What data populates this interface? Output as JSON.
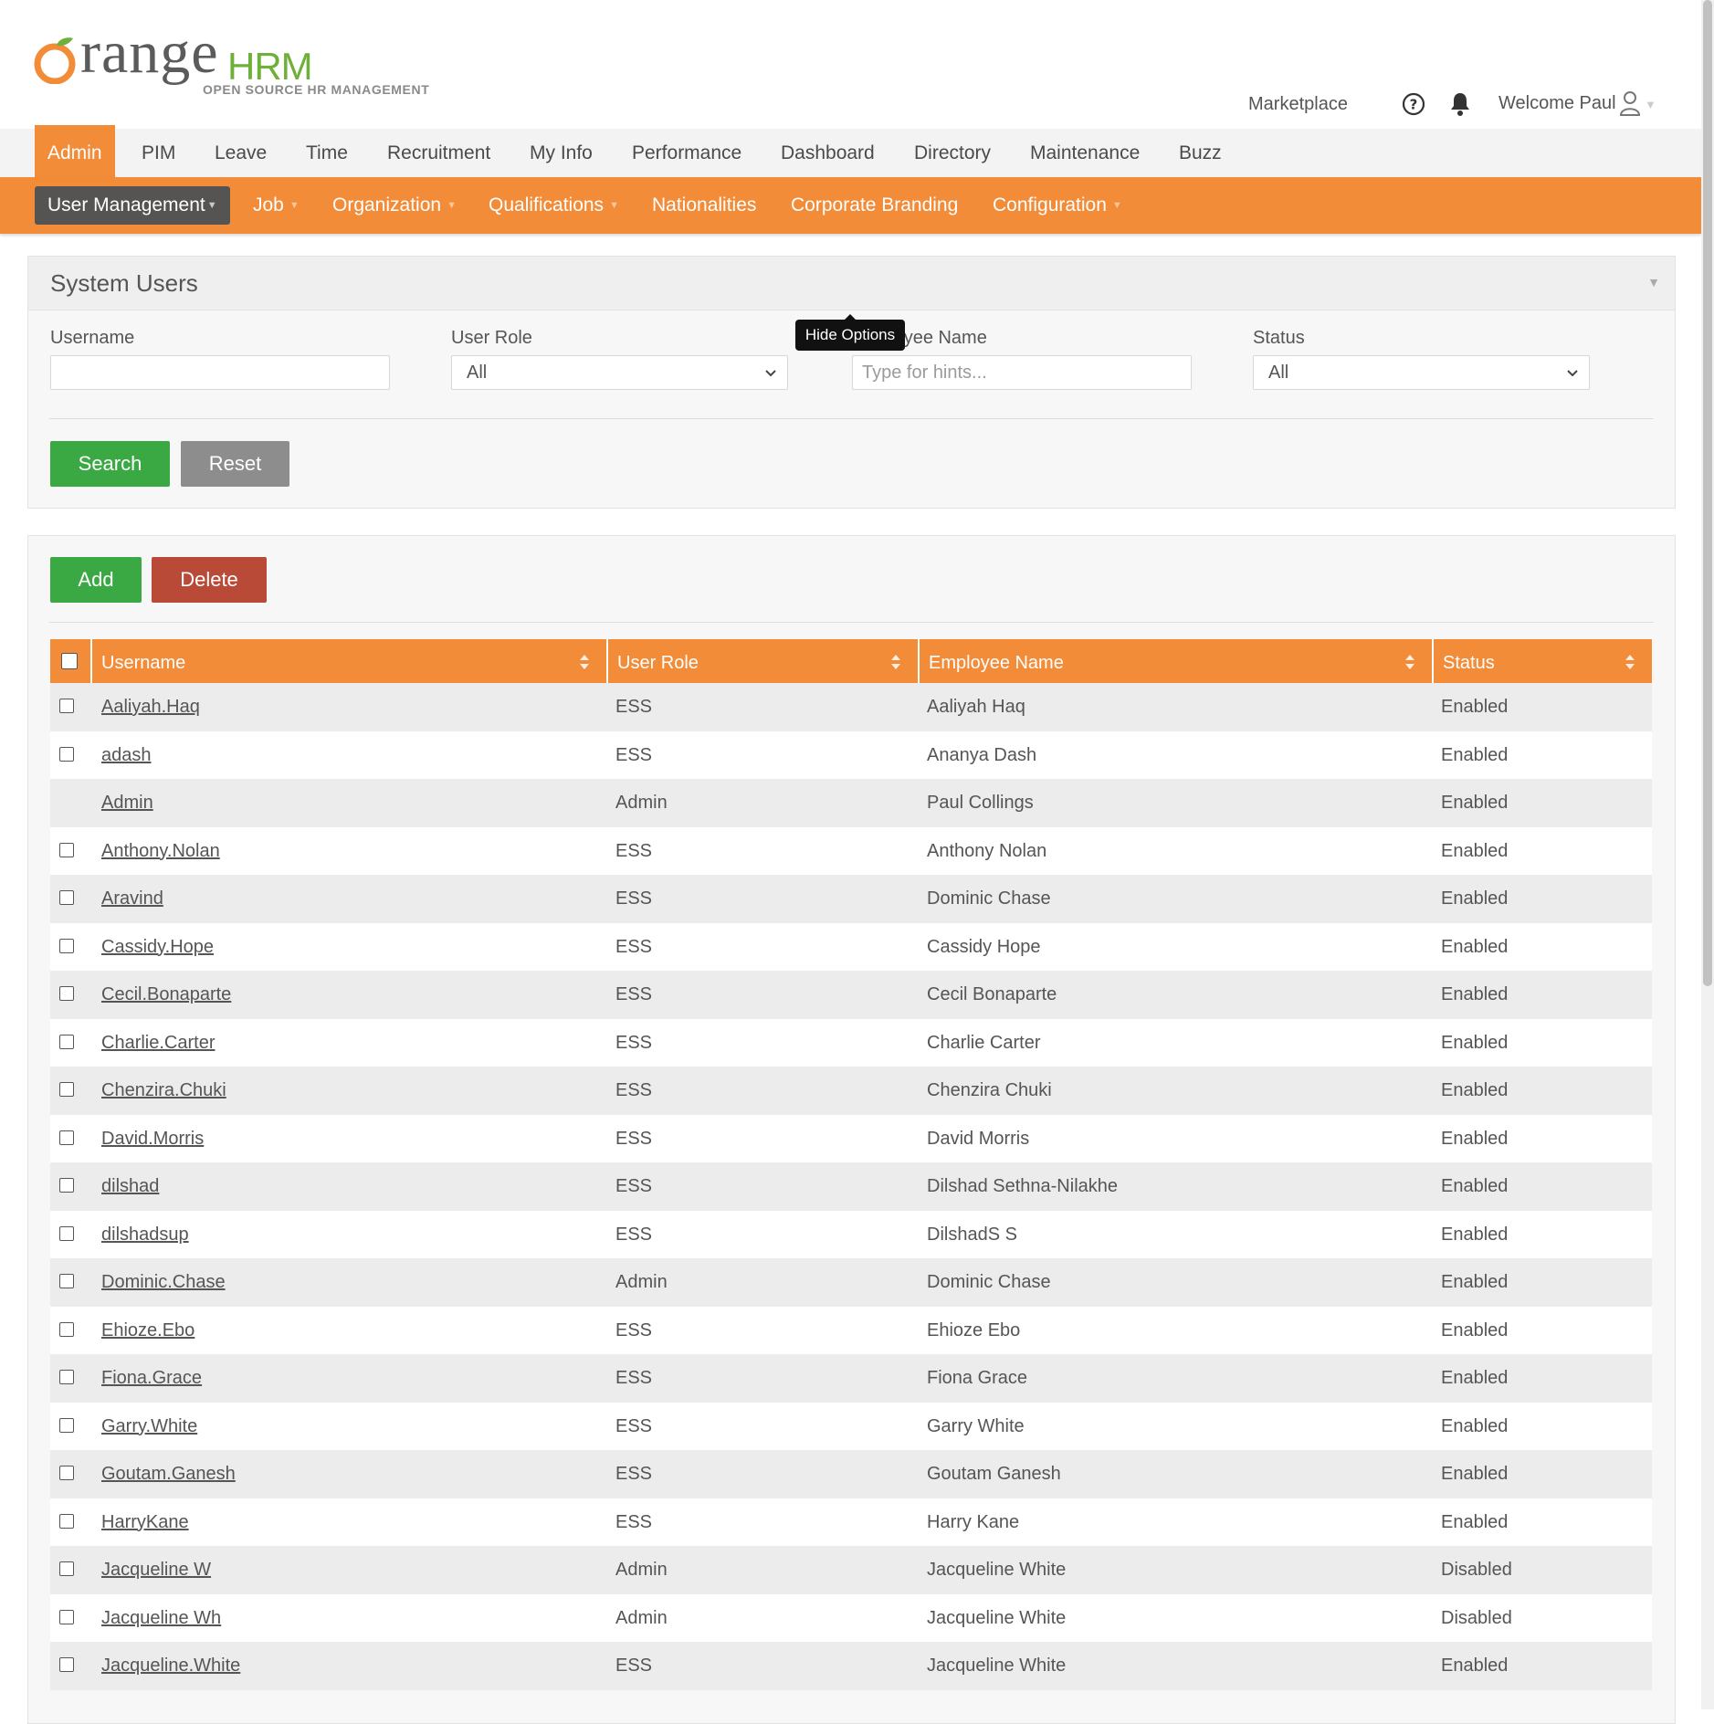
{
  "header": {
    "logo_word": "range",
    "logo_hrm": "HRM",
    "logo_tagline": "OPEN SOURCE HR MANAGEMENT",
    "marketplace": "Marketplace",
    "welcome": "Welcome Paul"
  },
  "main_nav": [
    "Admin",
    "PIM",
    "Leave",
    "Time",
    "Recruitment",
    "My Info",
    "Performance",
    "Dashboard",
    "Directory",
    "Maintenance",
    "Buzz"
  ],
  "sub_nav": [
    {
      "label": "User Management",
      "caret": true
    },
    {
      "label": "Job",
      "caret": true
    },
    {
      "label": "Organization",
      "caret": true
    },
    {
      "label": "Qualifications",
      "caret": true
    },
    {
      "label": "Nationalities",
      "caret": false
    },
    {
      "label": "Corporate Branding",
      "caret": false
    },
    {
      "label": "Configuration",
      "caret": true
    }
  ],
  "search": {
    "title": "System Users",
    "username_label": "Username",
    "username_value": "",
    "user_role_label": "User Role",
    "user_role_value": "All",
    "employee_label": "Employee Name",
    "employee_placeholder": "Type for hints...",
    "status_label": "Status",
    "status_value": "All",
    "search_button": "Search",
    "reset_button": "Reset",
    "tooltip": "Hide Options"
  },
  "list": {
    "add_button": "Add",
    "delete_button": "Delete",
    "columns": [
      "Username",
      "User Role",
      "Employee Name",
      "Status"
    ],
    "rows": [
      {
        "username": "Aaliyah.Haq",
        "role": "ESS",
        "employee": "Aaliyah Haq",
        "status": "Enabled",
        "checkbox": true
      },
      {
        "username": "adash",
        "role": "ESS",
        "employee": "Ananya Dash",
        "status": "Enabled",
        "checkbox": true
      },
      {
        "username": "Admin",
        "role": "Admin",
        "employee": "Paul Collings",
        "status": "Enabled",
        "checkbox": false
      },
      {
        "username": "Anthony.Nolan",
        "role": "ESS",
        "employee": "Anthony Nolan",
        "status": "Enabled",
        "checkbox": true
      },
      {
        "username": "Aravind",
        "role": "ESS",
        "employee": "Dominic Chase",
        "status": "Enabled",
        "checkbox": true
      },
      {
        "username": "Cassidy.Hope",
        "role": "ESS",
        "employee": "Cassidy Hope",
        "status": "Enabled",
        "checkbox": true
      },
      {
        "username": "Cecil.Bonaparte",
        "role": "ESS",
        "employee": "Cecil Bonaparte",
        "status": "Enabled",
        "checkbox": true
      },
      {
        "username": "Charlie.Carter",
        "role": "ESS",
        "employee": "Charlie Carter",
        "status": "Enabled",
        "checkbox": true
      },
      {
        "username": "Chenzira.Chuki",
        "role": "ESS",
        "employee": "Chenzira Chuki",
        "status": "Enabled",
        "checkbox": true
      },
      {
        "username": "David.Morris",
        "role": "ESS",
        "employee": "David Morris",
        "status": "Enabled",
        "checkbox": true
      },
      {
        "username": "dilshad",
        "role": "ESS",
        "employee": "Dilshad Sethna-Nilakhe",
        "status": "Enabled",
        "checkbox": true
      },
      {
        "username": "dilshadsup",
        "role": "ESS",
        "employee": "DilshadS S",
        "status": "Enabled",
        "checkbox": true
      },
      {
        "username": "Dominic.Chase",
        "role": "Admin",
        "employee": "Dominic Chase",
        "status": "Enabled",
        "checkbox": true
      },
      {
        "username": "Ehioze.Ebo",
        "role": "ESS",
        "employee": "Ehioze Ebo",
        "status": "Enabled",
        "checkbox": true
      },
      {
        "username": "Fiona.Grace",
        "role": "ESS",
        "employee": "Fiona Grace",
        "status": "Enabled",
        "checkbox": true
      },
      {
        "username": "Garry.White",
        "role": "ESS",
        "employee": "Garry White",
        "status": "Enabled",
        "checkbox": true
      },
      {
        "username": "Goutam.Ganesh",
        "role": "ESS",
        "employee": "Goutam Ganesh",
        "status": "Enabled",
        "checkbox": true
      },
      {
        "username": "HarryKane",
        "role": "ESS",
        "employee": "Harry Kane",
        "status": "Enabled",
        "checkbox": true
      },
      {
        "username": "Jacqueline W",
        "role": "Admin",
        "employee": "Jacqueline White",
        "status": "Disabled",
        "checkbox": true
      },
      {
        "username": "Jacqueline Wh",
        "role": "Admin",
        "employee": "Jacqueline White",
        "status": "Disabled",
        "checkbox": true
      },
      {
        "username": "Jacqueline.White",
        "role": "ESS",
        "employee": "Jacqueline White",
        "status": "Enabled",
        "checkbox": true
      }
    ]
  },
  "colors": {
    "accent": "#f28c38",
    "green": "#3aa843",
    "red": "#b94a38",
    "logo_green": "#6fb03a"
  },
  "icons": [
    "help-icon",
    "bell-icon",
    "user-icon",
    "chevron-down-icon",
    "sort-icon"
  ]
}
